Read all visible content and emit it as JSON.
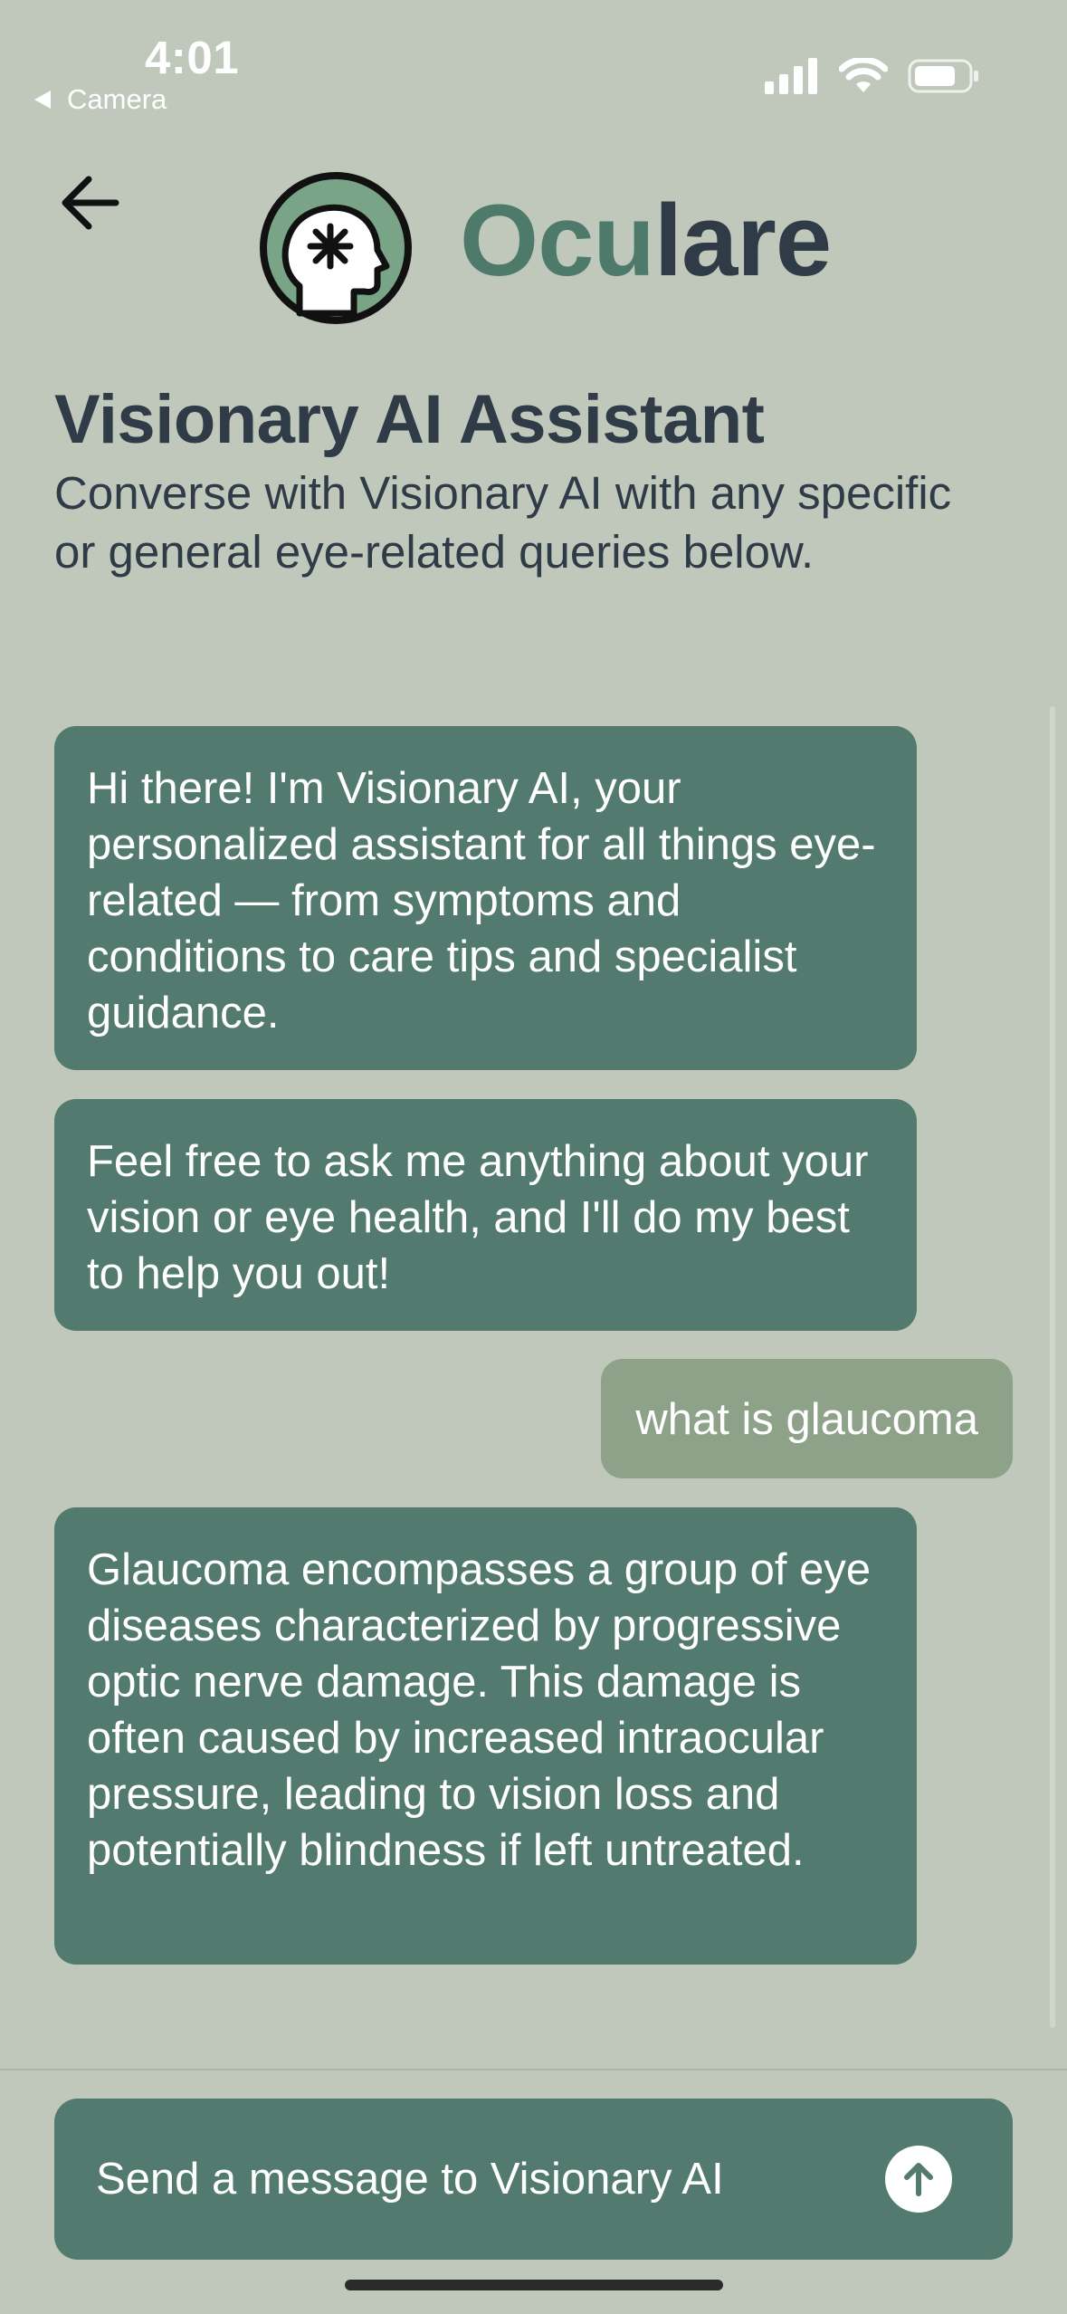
{
  "status_bar": {
    "time": "4:01",
    "back_app": "Camera",
    "signal_icon": "cellular-signal-icon",
    "wifi_icon": "wifi-icon",
    "battery_icon": "battery-icon"
  },
  "header": {
    "back_icon": "arrow-left-icon",
    "logo_icon": "head-eye-logo-icon",
    "brand_part1": "Ocu",
    "brand_part2": "lare"
  },
  "page": {
    "title": "Visionary AI Assistant",
    "subtitle": "Converse with Visionary AI with any specific or general eye-related queries below."
  },
  "messages": [
    {
      "role": "assistant",
      "text": "Hi there! I'm Visionary AI, your personalized assistant for all things eye-related — from symptoms and conditions to care tips and specialist guidance."
    },
    {
      "role": "assistant",
      "text": "Feel free to ask me anything about your vision or eye health, and I'll do my best to help you out!"
    },
    {
      "role": "user",
      "text": "what is glaucoma"
    },
    {
      "role": "assistant",
      "text": "Glaucoma encompasses a group of eye diseases characterized by progressive optic nerve damage. This damage is often caused by increased intraocular pressure, leading to vision loss and potentially blindness if left untreated."
    }
  ],
  "composer": {
    "value": "",
    "placeholder": "Send a message to Visionary AI",
    "send_icon": "arrow-up-icon"
  },
  "colors": {
    "background": "#c0c8bc",
    "assistant_bubble": "#527a6e",
    "user_bubble": "#8da288",
    "brand_accent": "#4e7a6b",
    "text_dark": "#2f3b47"
  }
}
